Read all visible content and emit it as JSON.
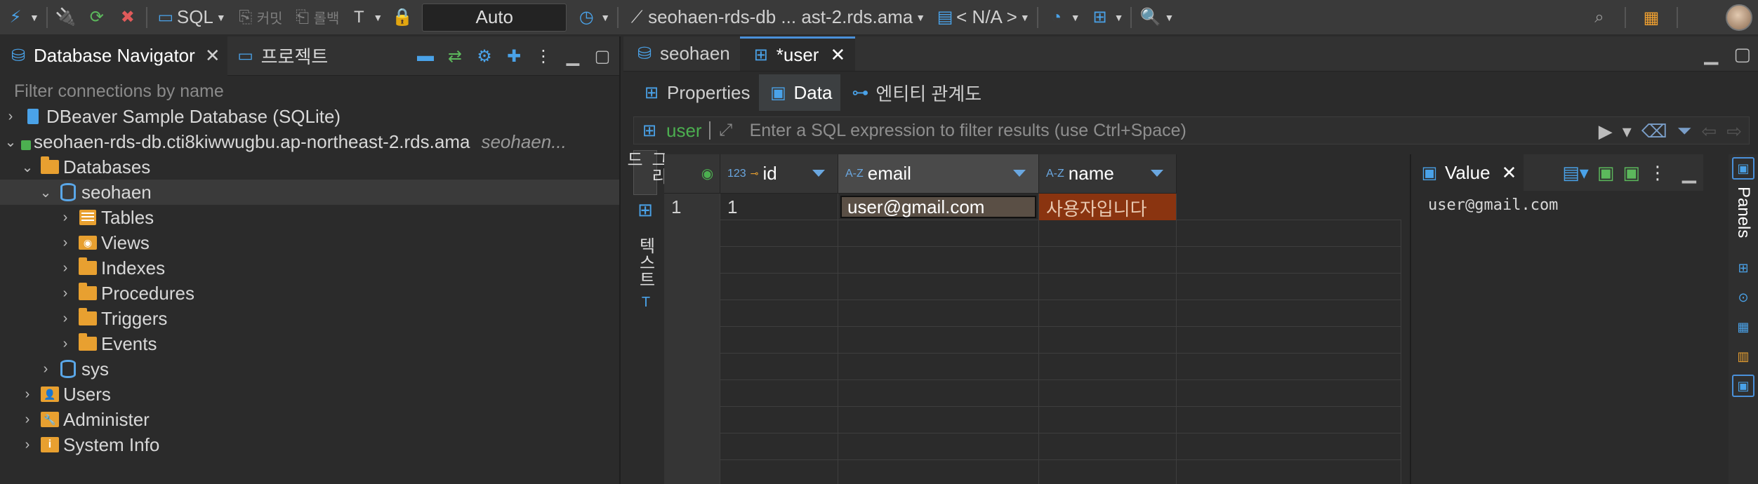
{
  "toolbar": {
    "sql_label": "SQL",
    "commit_label": "커밋",
    "rollback_label": "롤백",
    "transaction_mode": "Auto",
    "connection_label": "seohaen-rds-db ... ast-2.rds.ama",
    "schema_label": "< N/A >"
  },
  "left_panel": {
    "tabs": [
      {
        "label": "Database Navigator",
        "active": true
      },
      {
        "label": "프로젝트",
        "active": false
      }
    ],
    "filter_placeholder": "Filter connections by name",
    "tree": {
      "sample_db": "DBeaver Sample Database (SQLite)",
      "connection": "seohaen-rds-db.cti8kiwwugbu.ap-northeast-2.rds.ama",
      "connection_hint": "seohaen...",
      "databases": "Databases",
      "db_seohaen": "seohaen",
      "tables": "Tables",
      "views": "Views",
      "indexes": "Indexes",
      "procedures": "Procedures",
      "triggers": "Triggers",
      "events": "Events",
      "db_sys": "sys",
      "users": "Users",
      "administer": "Administer",
      "system_info": "System Info"
    }
  },
  "editor": {
    "tabs": [
      {
        "label": "seohaen",
        "active": false
      },
      {
        "label": "*user",
        "active": true
      }
    ],
    "subtabs": [
      {
        "label": "Properties",
        "active": false
      },
      {
        "label": "Data",
        "active": true
      },
      {
        "label": "엔티티 관계도",
        "active": false
      }
    ],
    "filter": {
      "table_name": "user",
      "placeholder": "Enter a SQL expression to filter results (use Ctrl+Space)"
    },
    "side_labels": {
      "grid": "그리드",
      "text": "텍스트"
    },
    "grid": {
      "columns": [
        {
          "type": "123",
          "name": "id"
        },
        {
          "type": "A-Z",
          "name": "email"
        },
        {
          "type": "A-Z",
          "name": "name"
        }
      ],
      "rows": [
        {
          "num": "1",
          "id": "1",
          "email": "user@gmail.com",
          "name": "사용자입니다"
        }
      ]
    },
    "value_panel": {
      "title": "Value",
      "value_text": "user@gmail.com"
    },
    "panels_label": "Panels"
  },
  "colors": {
    "accent": "#4a90d9",
    "selected_cell": "#5a4f45",
    "modified_cell": "#8a3410",
    "folder": "#e8a030",
    "table_name_green": "#4caf50"
  }
}
